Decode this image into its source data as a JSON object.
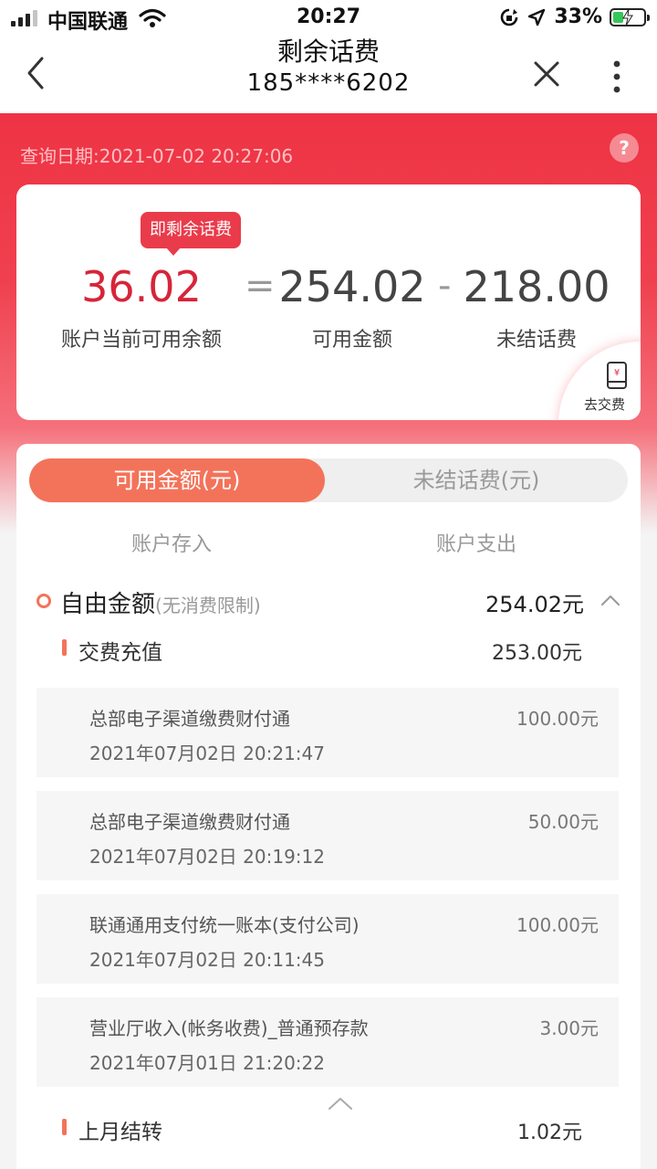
{
  "status_bar": {
    "carrier": "中国联通",
    "time": "20:27",
    "battery_percent": "33%",
    "battery_level": 0.33,
    "icons": [
      "signal-icon",
      "wifi-icon",
      "screen-lock-icon",
      "location-icon",
      "battery-charging-icon"
    ]
  },
  "nav": {
    "title": "剩余话费",
    "phone": "185****6202",
    "icons": [
      "back-icon",
      "close-icon",
      "more-icon"
    ]
  },
  "header": {
    "query_date": "查询日期:2021-07-02 20:27:06",
    "help_symbol": "?"
  },
  "summary": {
    "tag": "即剩余话费",
    "remaining": "36.02",
    "equals": "=",
    "available": "254.02",
    "minus": "-",
    "unsettled": "218.00",
    "remaining_label": "账户当前可用余额",
    "available_label": "可用金额",
    "unsettled_label": "未结话费",
    "pay_label": "去交费",
    "accent_color": "#d6253a"
  },
  "tabs": [
    {
      "label": "可用金额(元)",
      "active": true
    },
    {
      "label": "未结话费(元)",
      "active": false
    }
  ],
  "columns": {
    "income": "账户存入",
    "expense": "账户支出"
  },
  "free_balance": {
    "title": "自由金额",
    "subtitle": "(无消费限制)",
    "amount": "254.02元"
  },
  "recharge": {
    "title": "交费充值",
    "amount": "253.00元",
    "items": [
      {
        "name": "总部电子渠道缴费财付通",
        "time": "2021年07月02日 20:21:47",
        "amount": "100.00元"
      },
      {
        "name": "总部电子渠道缴费财付通",
        "time": "2021年07月02日 20:19:12",
        "amount": "50.00元"
      },
      {
        "name": "联通通用支付统一账本(支付公司)",
        "time": "2021年07月02日 20:11:45",
        "amount": "100.00元"
      },
      {
        "name": "营业厅收入(帐务收费)_普通预存款",
        "time": "2021年07月01日 21:20:22",
        "amount": "3.00元"
      }
    ]
  },
  "carryover": {
    "title": "上月结转",
    "amount": "1.02元"
  },
  "colors": {
    "brand_red": "#ee3344",
    "tab_active": "#f3735a"
  }
}
